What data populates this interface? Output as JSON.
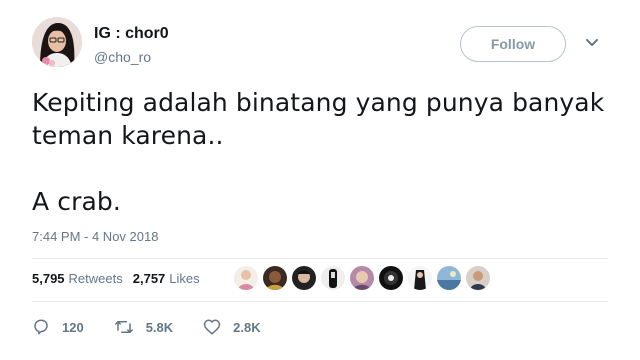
{
  "profile": {
    "display_name": "IG : chor0",
    "handle": "@cho_ro"
  },
  "header": {
    "follow_label": "Follow",
    "caret_icon": "chevron-down-icon"
  },
  "tweet": {
    "line1": "Kepiting adalah binatang yang punya banyak",
    "line2": "teman karena..",
    "line3": "A crab.",
    "timestamp": "7:44 PM - 4 Nov 2018"
  },
  "stats": {
    "retweets_count": "5,795",
    "retweets_label": "Retweets",
    "likes_count": "2,757",
    "likes_label": "Likes"
  },
  "actions": {
    "replies": "120",
    "retweets": "5.8K",
    "likes": "2.8K"
  },
  "colors": {
    "text": "#14171a",
    "muted": "#657786",
    "border": "#e6ecf0"
  }
}
